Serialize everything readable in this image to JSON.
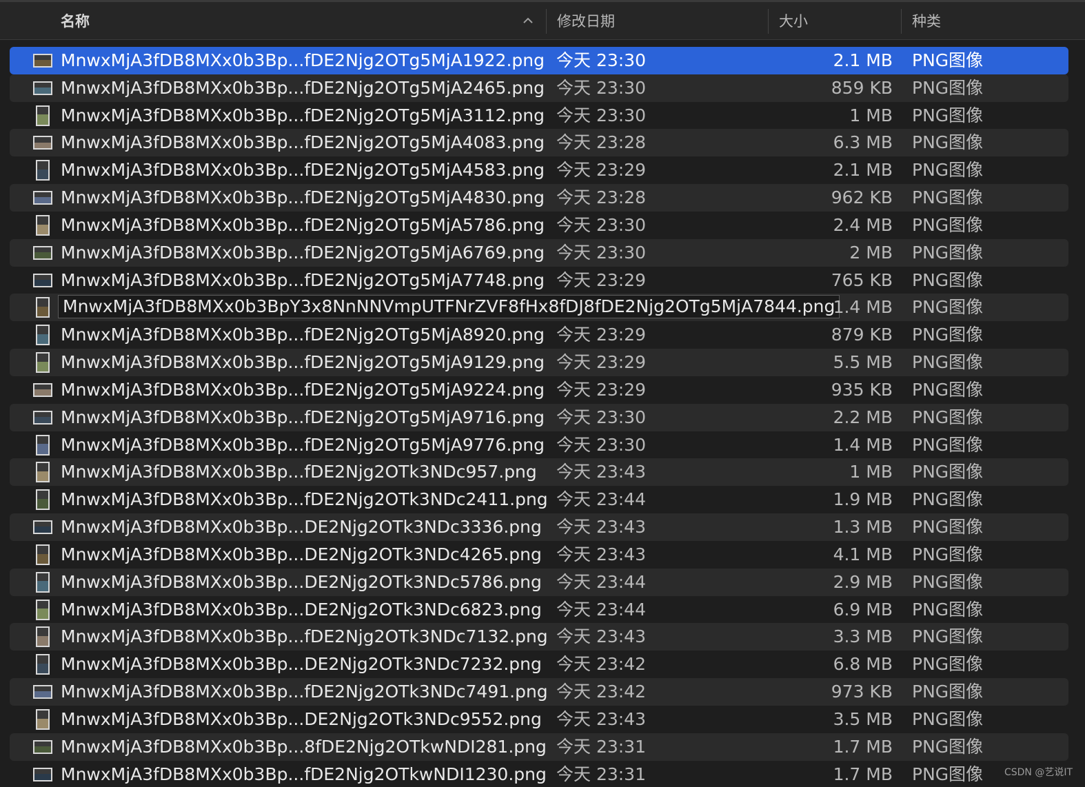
{
  "columns": {
    "name": "名称",
    "date": "修改日期",
    "size": "大小",
    "kind": "种类"
  },
  "sort_icon": "chevron-up-icon",
  "colors": {
    "selection": "#2b63d9",
    "row_alt": "#2b2b2b",
    "background": "#1e1e1e"
  },
  "files": [
    {
      "name": "MnwxMjA3fDB8MXx0b3Bp...fDE2Njg2OTg5MjA1922.png",
      "date": "今天 23:30",
      "size": "2.1 MB",
      "kind": "PNG图像",
      "thumb": "wide"
    },
    {
      "name": "MnwxMjA3fDB8MXx0b3Bp...fDE2Njg2OTg5MjA2465.png",
      "date": "今天 23:30",
      "size": "859 KB",
      "kind": "PNG图像",
      "thumb": "wide"
    },
    {
      "name": "MnwxMjA3fDB8MXx0b3Bp...fDE2Njg2OTg5MjA3112.png",
      "date": "今天 23:30",
      "size": "1 MB",
      "kind": "PNG图像",
      "thumb": "tall"
    },
    {
      "name": "MnwxMjA3fDB8MXx0b3Bp...fDE2Njg2OTg5MjA4083.png",
      "date": "今天 23:28",
      "size": "6.3 MB",
      "kind": "PNG图像",
      "thumb": "wide"
    },
    {
      "name": "MnwxMjA3fDB8MXx0b3Bp...fDE2Njg2OTg5MjA4583.png",
      "date": "今天 23:29",
      "size": "2.1 MB",
      "kind": "PNG图像",
      "thumb": "tall"
    },
    {
      "name": "MnwxMjA3fDB8MXx0b3Bp...fDE2Njg2OTg5MjA4830.png",
      "date": "今天 23:28",
      "size": "962 KB",
      "kind": "PNG图像",
      "thumb": "wide"
    },
    {
      "name": "MnwxMjA3fDB8MXx0b3Bp...fDE2Njg2OTg5MjA5786.png",
      "date": "今天 23:30",
      "size": "2.4 MB",
      "kind": "PNG图像",
      "thumb": "tall"
    },
    {
      "name": "MnwxMjA3fDB8MXx0b3Bp...fDE2Njg2OTg5MjA6769.png",
      "date": "今天 23:30",
      "size": "2 MB",
      "kind": "PNG图像",
      "thumb": "wide"
    },
    {
      "name": "MnwxMjA3fDB8MXx0b3Bp...fDE2Njg2OTg5MjA7748.png",
      "date": "今天 23:29",
      "size": "765 KB",
      "kind": "PNG图像",
      "thumb": "wide"
    },
    {
      "name": "MnwxMjA3fDB8MXx0b3BpY3x8NnNNVmpUTFNrZVF8fHx8fDJ8fDE2Njg2OTg5MjA7844.png",
      "date": "",
      "size": "1.4 MB",
      "kind": "PNG图像",
      "thumb": "tall",
      "editing": true
    },
    {
      "name": "MnwxMjA3fDB8MXx0b3Bp...fDE2Njg2OTg5MjA8920.png",
      "date": "今天 23:29",
      "size": "879 KB",
      "kind": "PNG图像",
      "thumb": "tall"
    },
    {
      "name": "MnwxMjA3fDB8MXx0b3Bp...fDE2Njg2OTg5MjA9129.png",
      "date": "今天 23:29",
      "size": "5.5 MB",
      "kind": "PNG图像",
      "thumb": "tall"
    },
    {
      "name": "MnwxMjA3fDB8MXx0b3Bp...fDE2Njg2OTg5MjA9224.png",
      "date": "今天 23:29",
      "size": "935 KB",
      "kind": "PNG图像",
      "thumb": "wide"
    },
    {
      "name": "MnwxMjA3fDB8MXx0b3Bp...fDE2Njg2OTg5MjA9716.png",
      "date": "今天 23:30",
      "size": "2.2 MB",
      "kind": "PNG图像",
      "thumb": "wide"
    },
    {
      "name": "MnwxMjA3fDB8MXx0b3Bp...fDE2Njg2OTg5MjA9776.png",
      "date": "今天 23:30",
      "size": "1.4 MB",
      "kind": "PNG图像",
      "thumb": "tall"
    },
    {
      "name": "MnwxMjA3fDB8MXx0b3Bp...fDE2Njg2OTk3NDc957.png",
      "date": "今天 23:43",
      "size": "1 MB",
      "kind": "PNG图像",
      "thumb": "tall"
    },
    {
      "name": "MnwxMjA3fDB8MXx0b3Bp...fDE2Njg2OTk3NDc2411.png",
      "date": "今天 23:44",
      "size": "1.9 MB",
      "kind": "PNG图像",
      "thumb": "tall"
    },
    {
      "name": "MnwxMjA3fDB8MXx0b3Bp...DE2Njg2OTk3NDc3336.png",
      "date": "今天 23:43",
      "size": "1.3 MB",
      "kind": "PNG图像",
      "thumb": "wide"
    },
    {
      "name": "MnwxMjA3fDB8MXx0b3Bp...DE2Njg2OTk3NDc4265.png",
      "date": "今天 23:43",
      "size": "4.1 MB",
      "kind": "PNG图像",
      "thumb": "tall"
    },
    {
      "name": "MnwxMjA3fDB8MXx0b3Bp...DE2Njg2OTk3NDc5786.png",
      "date": "今天 23:44",
      "size": "2.9 MB",
      "kind": "PNG图像",
      "thumb": "tall"
    },
    {
      "name": "MnwxMjA3fDB8MXx0b3Bp...DE2Njg2OTk3NDc6823.png",
      "date": "今天 23:44",
      "size": "6.9 MB",
      "kind": "PNG图像",
      "thumb": "tall"
    },
    {
      "name": "MnwxMjA3fDB8MXx0b3Bp...fDE2Njg2OTk3NDc7132.png",
      "date": "今天 23:43",
      "size": "3.3 MB",
      "kind": "PNG图像",
      "thumb": "tall"
    },
    {
      "name": "MnwxMjA3fDB8MXx0b3Bp...DE2Njg2OTk3NDc7232.png",
      "date": "今天 23:42",
      "size": "6.8 MB",
      "kind": "PNG图像",
      "thumb": "tall"
    },
    {
      "name": "MnwxMjA3fDB8MXx0b3Bp...fDE2Njg2OTk3NDc7491.png",
      "date": "今天 23:42",
      "size": "973 KB",
      "kind": "PNG图像",
      "thumb": "wide"
    },
    {
      "name": "MnwxMjA3fDB8MXx0b3Bp...DE2Njg2OTk3NDc9552.png",
      "date": "今天 23:43",
      "size": "3.5 MB",
      "kind": "PNG图像",
      "thumb": "tall"
    },
    {
      "name": "MnwxMjA3fDB8MXx0b3Bp...8fDE2Njg2OTkwNDI281.png",
      "date": "今天 23:31",
      "size": "1.7 MB",
      "kind": "PNG图像",
      "thumb": "wide"
    },
    {
      "name": "MnwxMjA3fDB8MXx0b3Bp...fDE2Njg2OTkwNDI1230.png",
      "date": "今天 23:31",
      "size": "1.7 MB",
      "kind": "PNG图像",
      "thumb": "wide"
    }
  ],
  "selected_index": 0,
  "watermark": "CSDN @艺说IT"
}
